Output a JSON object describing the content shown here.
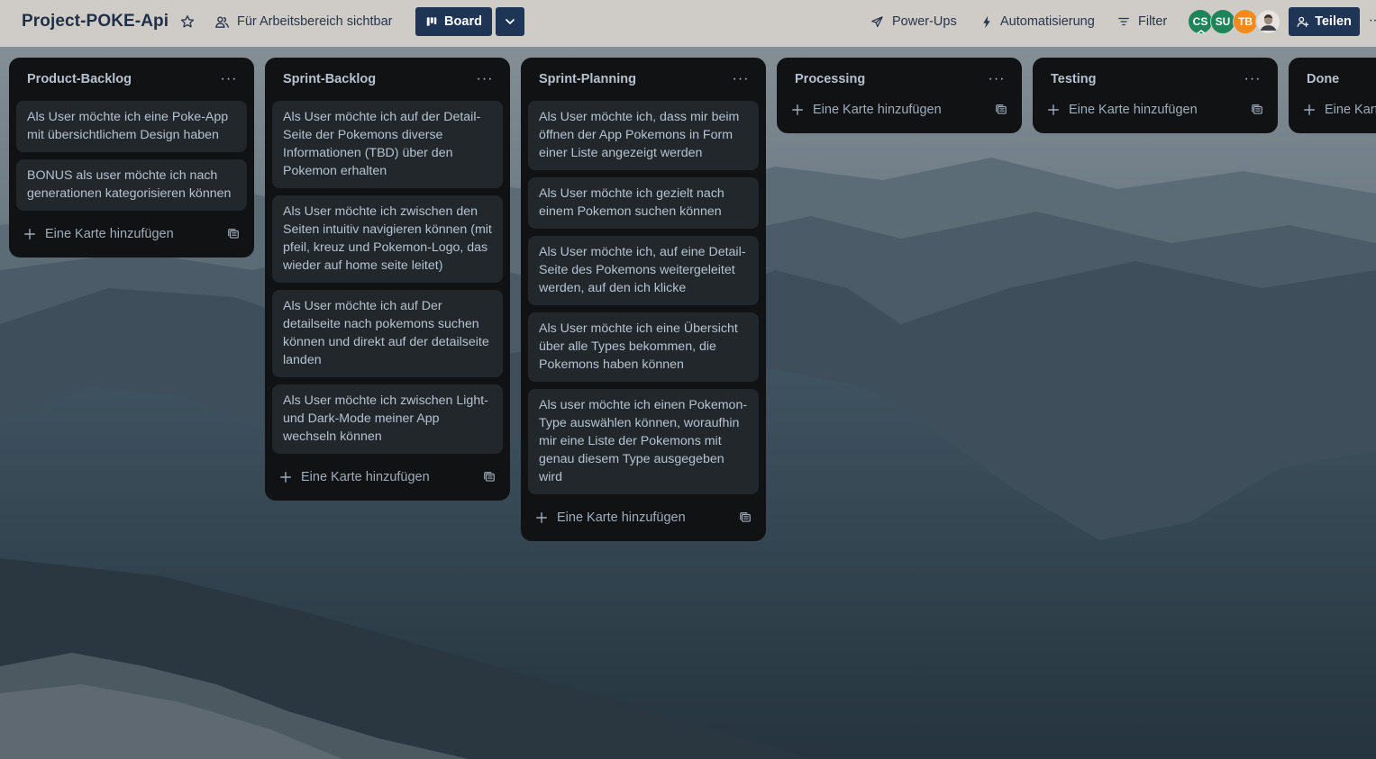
{
  "header": {
    "board_title": "Project-POKE-Api",
    "visibility_label": "Für Arbeitsbereich sichtbar",
    "board_view_label": "Board",
    "powerups_label": "Power-Ups",
    "automation_label": "Automatisierung",
    "filter_label": "Filter",
    "share_label": "Teilen",
    "members": [
      {
        "initials": "CS",
        "color": "#1f845a"
      },
      {
        "initials": "SU",
        "color": "#1f845a"
      },
      {
        "initials": "TB",
        "color": "#f38a1d"
      }
    ]
  },
  "add_card_label": "Eine Karte hinzufügen",
  "lists": [
    {
      "title": "Product-Backlog",
      "cards": [
        "Als User möchte ich eine Poke-App mit übersichtlichem Design haben",
        "BONUS als user möchte ich nach generationen kategorisieren können"
      ]
    },
    {
      "title": "Sprint-Backlog",
      "cards": [
        "Als User möchte ich auf der Detail-Seite der Pokemons diverse Informationen (TBD) über den Pokemon erhalten",
        "Als User möchte ich zwischen den Seiten intuitiv navigieren können (mit pfeil, kreuz und Pokemon-Logo, das wieder auf home seite leitet)",
        "Als User möchte ich auf Der detailseite nach pokemons suchen können und direkt auf der detailseite landen",
        "Als User möchte ich zwischen Light- und Dark-Mode meiner App wechseln können"
      ]
    },
    {
      "title": "Sprint-Planning",
      "cards": [
        "Als User möchte ich, dass mir beim öffnen der App Pokemons in Form einer Liste angezeigt werden",
        "Als User möchte ich gezielt nach einem Pokemon suchen können",
        "Als User möchte ich, auf eine Detail-Seite des Pokemons weitergeleitet werden, auf den ich klicke",
        "Als User möchte ich eine Übersicht über alle Types bekommen, die Pokemons haben können",
        "Als user möchte ich einen Pokemon-Type auswählen können, woraufhin mir eine Liste der Pokemons mit genau diesem Type ausgegeben wird"
      ]
    },
    {
      "title": "Processing",
      "cards": []
    },
    {
      "title": "Testing",
      "cards": []
    },
    {
      "title": "Done",
      "cards": []
    }
  ]
}
